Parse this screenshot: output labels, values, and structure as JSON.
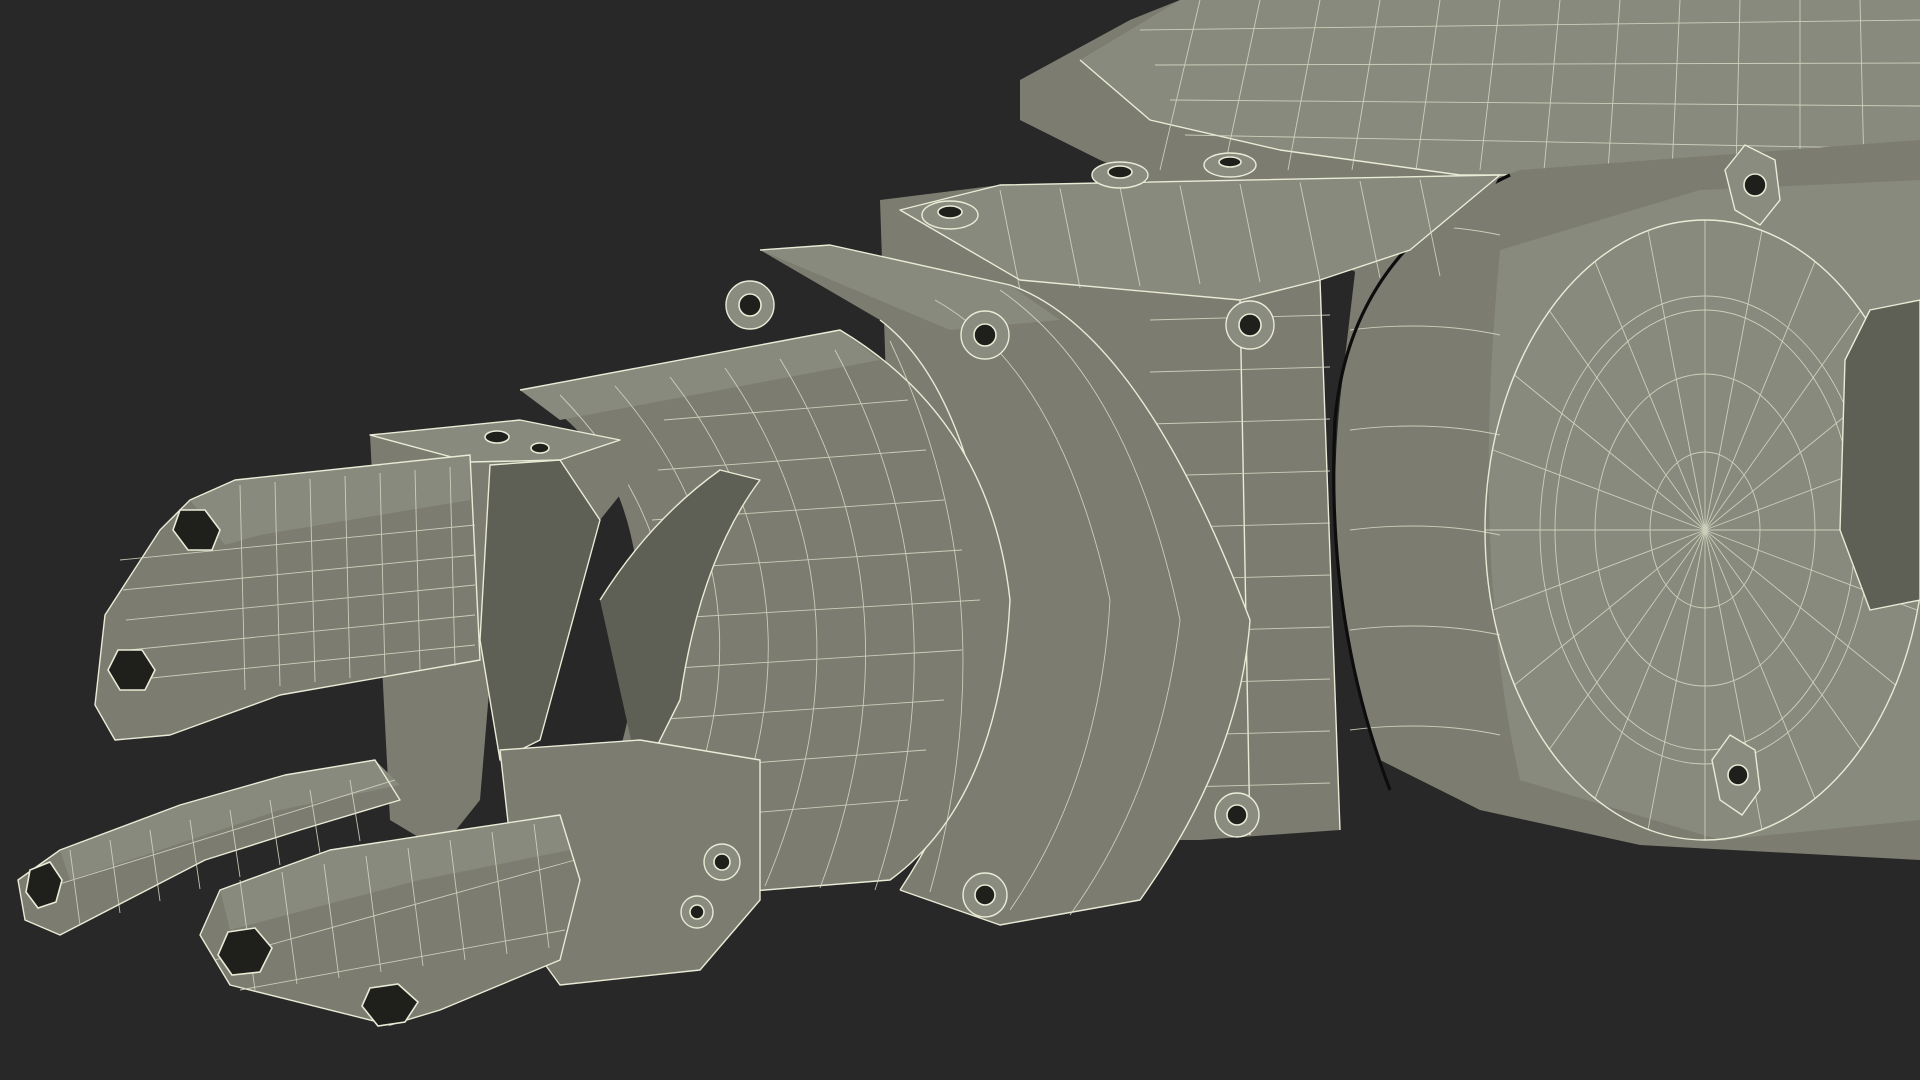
{
  "scene": {
    "background_color": "#282828",
    "surface_color": "#7c7c70",
    "wire_color": "#e9ebd6",
    "style": "wireframe-over-shaded"
  }
}
